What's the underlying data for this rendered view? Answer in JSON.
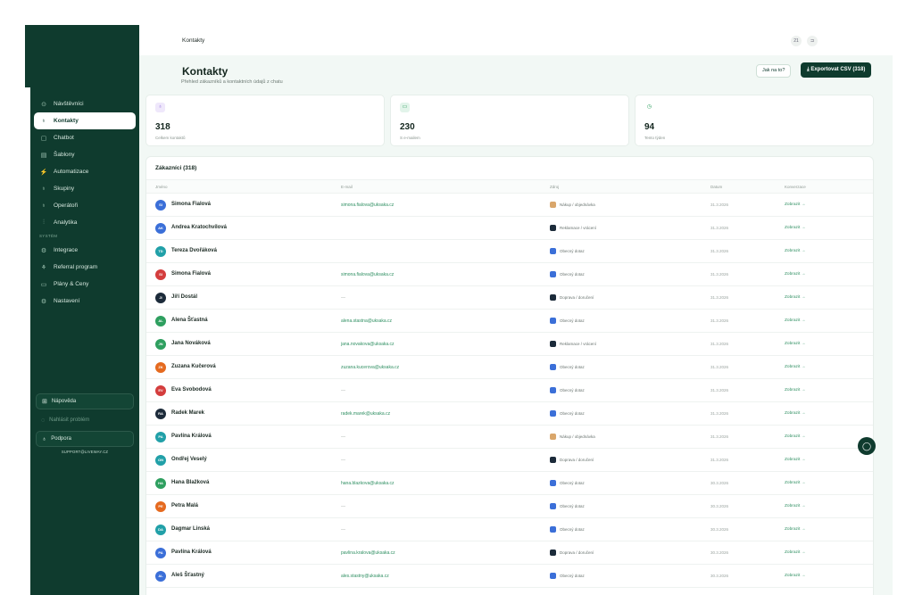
{
  "topbar": {
    "crumb": "Kontakty",
    "btn1": "21",
    "btn2": "⊐"
  },
  "sidebar": {
    "items": [
      {
        "icon": "⊙",
        "label": "Návštěvníci"
      },
      {
        "icon": "♁",
        "label": "Kontakty"
      },
      {
        "icon": "▢",
        "label": "Chatbot"
      },
      {
        "icon": "▤",
        "label": "Šablony"
      },
      {
        "icon": "⚡",
        "label": "Automatizace"
      },
      {
        "icon": "♁",
        "label": "Skupiny"
      },
      {
        "icon": "♁",
        "label": "Operátoři"
      },
      {
        "icon": "⫶",
        "label": "Analytika"
      }
    ],
    "section_label": "SYSTÉM",
    "system_items": [
      {
        "icon": "⚙",
        "label": "Integrace"
      },
      {
        "icon": "⚘",
        "label": "Referral program"
      },
      {
        "icon": "▭",
        "label": "Plány & Ceny"
      },
      {
        "icon": "⚙",
        "label": "Nastavení"
      }
    ],
    "bottom": {
      "help": "Nápověda",
      "report": "Nahlásit problém",
      "support": "Podpora",
      "support_email": "SUPPORT@LIVEWAY.CZ"
    }
  },
  "header": {
    "title": "Kontakty",
    "subtitle": "Přehled zákazníků a kontaktních údajů z chatu",
    "help_button": "Jak na to?",
    "export_button": "Exportovat CSV (318)"
  },
  "stats": [
    {
      "value": "318",
      "label": "Celkem kontaktů"
    },
    {
      "value": "230",
      "label": "S e-mailem"
    },
    {
      "value": "94",
      "label": "Tento týden"
    }
  ],
  "table": {
    "title": "Zákazníci (318)",
    "headers": {
      "name": "Jméno",
      "email": "E-mail",
      "source": "Zdroj",
      "date": "Datum",
      "conversation": "Konverzace"
    },
    "rows": [
      {
        "initials": "SI",
        "color": "#3b6fd8",
        "name": "Simona Fialová",
        "email": "simona.fialova@uksaka.cz",
        "source": "Nákup / objednávka",
        "src_color": "#d9a66b",
        "date": "31.3.2026",
        "action": "Zobrazit →"
      },
      {
        "initials": "AK",
        "color": "#3b6fd8",
        "name": "Andrea Kratochvílová",
        "email": "",
        "source": "Reklamace / vrácení",
        "src_color": "#1c2b3a",
        "date": "31.3.2026",
        "action": "Zobrazit →"
      },
      {
        "initials": "TD",
        "color": "#21a0a8",
        "name": "Tereza Dvořáková",
        "email": "",
        "source": "Obecný dotaz",
        "src_color": "#3b6fd8",
        "date": "31.3.2026",
        "action": "Zobrazit →"
      },
      {
        "initials": "SI",
        "color": "#d43d3d",
        "name": "Simona Fialová",
        "email": "simona.fialova@uksaka.cz",
        "source": "Obecný dotaz",
        "src_color": "#3b6fd8",
        "date": "31.3.2026",
        "action": "Zobrazit →"
      },
      {
        "initials": "JI",
        "color": "#1c2b3a",
        "name": "Jiří Dostál",
        "email": "—",
        "source": "Doprava / doručení",
        "src_color": "#1c2b3a",
        "date": "31.3.2026",
        "action": "Zobrazit →"
      },
      {
        "initials": "AL",
        "color": "#2e9f5f",
        "name": "Alena Šťastná",
        "email": "alena.stastna@uksaka.cz",
        "source": "Obecný dotaz",
        "src_color": "#3b6fd8",
        "date": "31.3.2026",
        "action": "Zobrazit →"
      },
      {
        "initials": "JN",
        "color": "#2e9f5f",
        "name": "Jana Nováková",
        "email": "jana.novakova@uksaka.cz",
        "source": "Reklamace / vrácení",
        "src_color": "#1c2b3a",
        "date": "31.3.2026",
        "action": "Zobrazit →"
      },
      {
        "initials": "ZK",
        "color": "#e56a1f",
        "name": "Zuzana Kučerová",
        "email": "zuzana.kucerova@uksaka.cz",
        "source": "Obecný dotaz",
        "src_color": "#3b6fd8",
        "date": "31.3.2026",
        "action": "Zobrazit →"
      },
      {
        "initials": "EV",
        "color": "#d43d3d",
        "name": "Eva Svobodová",
        "email": "—",
        "source": "Obecný dotaz",
        "src_color": "#3b6fd8",
        "date": "31.3.2026",
        "action": "Zobrazit →"
      },
      {
        "initials": "RA",
        "color": "#1c2b3a",
        "name": "Radek Marek",
        "email": "radek.marek@uksaka.cz",
        "source": "Obecný dotaz",
        "src_color": "#3b6fd8",
        "date": "31.3.2026",
        "action": "Zobrazit →"
      },
      {
        "initials": "PA",
        "color": "#21a0a8",
        "name": "Pavlína Králová",
        "email": "—",
        "source": "Nákup / objednávka",
        "src_color": "#d9a66b",
        "date": "31.3.2026",
        "action": "Zobrazit →"
      },
      {
        "initials": "ON",
        "color": "#21a0a8",
        "name": "Ondřej Veselý",
        "email": "—",
        "source": "Doprava / doručení",
        "src_color": "#1c2b3a",
        "date": "31.3.2026",
        "action": "Zobrazit →"
      },
      {
        "initials": "HA",
        "color": "#2e9f5f",
        "name": "Hana Blažková",
        "email": "hana.blazkova@uksaka.cz",
        "source": "Obecný dotaz",
        "src_color": "#3b6fd8",
        "date": "30.3.2026",
        "action": "Zobrazit →"
      },
      {
        "initials": "PE",
        "color": "#e56a1f",
        "name": "Petra Malá",
        "email": "—",
        "source": "Obecný dotaz",
        "src_color": "#3b6fd8",
        "date": "30.3.2026",
        "action": "Zobrazit →"
      },
      {
        "initials": "DA",
        "color": "#21a0a8",
        "name": "Dagmar Linská",
        "email": "—",
        "source": "Obecný dotaz",
        "src_color": "#3b6fd8",
        "date": "30.3.2026",
        "action": "Zobrazit →"
      },
      {
        "initials": "PA",
        "color": "#3b6fd8",
        "name": "Pavlína Králová",
        "email": "pavlina.kralova@uksaka.cz",
        "source": "Doprava / doručení",
        "src_color": "#1c2b3a",
        "date": "30.3.2026",
        "action": "Zobrazit →"
      },
      {
        "initials": "AL",
        "color": "#3b6fd8",
        "name": "Aleš Šťastný",
        "email": "ales.stastny@uksaka.cz",
        "source": "Obecný dotaz",
        "src_color": "#3b6fd8",
        "date": "30.3.2026",
        "action": "Zobrazit →"
      }
    ]
  },
  "colors": {
    "brand": "#0f3b2e",
    "accent": "#2f8f62",
    "background": "#f2f8f5"
  }
}
